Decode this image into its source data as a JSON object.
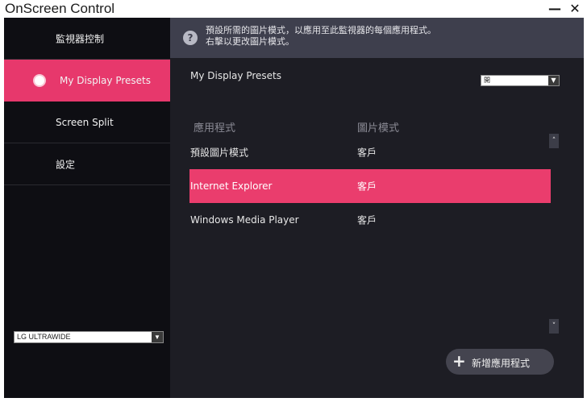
{
  "window": {
    "title": "OnScreen Control",
    "minimize_label": "—",
    "close_label": "✕"
  },
  "sidebar": {
    "items": [
      {
        "label": "監視器控制"
      },
      {
        "label": "My Display Presets"
      },
      {
        "label": "Screen Split"
      },
      {
        "label": "設定"
      }
    ],
    "active_index": 1,
    "monitor_select": {
      "value": "LG ULTRAWIDE",
      "arrow": "▼"
    }
  },
  "info": {
    "icon": "help-icon",
    "line1": "預設所需的圖片模式，以應用至此監視器的每個應用程式。",
    "line2": "右擊以更改圖片模式。"
  },
  "presets": {
    "label": "My Display Presets",
    "select_value": "開",
    "select_arrow": "▼",
    "columns": {
      "app": "應用程式",
      "mode": "圖片模式"
    },
    "rows": [
      {
        "app": "預設圖片模式",
        "mode": "客戶"
      },
      {
        "app": "Internet Explorer",
        "mode": "客戶"
      },
      {
        "app": "Windows Media Player",
        "mode": "客戶"
      }
    ],
    "selected_row": 1,
    "scroll_up": "˄",
    "scroll_down": "˅",
    "add_button": {
      "icon": "plus-icon",
      "plus": "+",
      "label": "新增應用程式"
    }
  },
  "colors": {
    "accent": "#e7386c",
    "sidebar_bg": "#0e0e13",
    "content_bg": "#1d1d24",
    "info_bg": "#3e3f4d"
  }
}
